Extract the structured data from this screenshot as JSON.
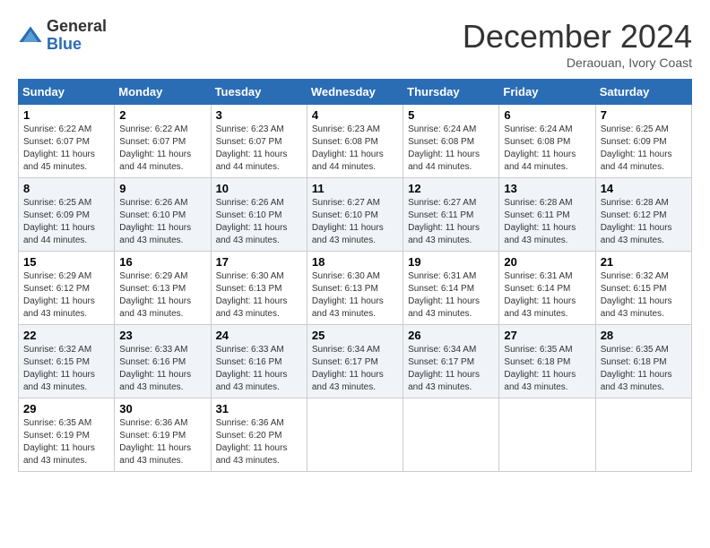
{
  "logo": {
    "general": "General",
    "blue": "Blue"
  },
  "header": {
    "month": "December 2024",
    "location": "Deraouan, Ivory Coast"
  },
  "weekdays": [
    "Sunday",
    "Monday",
    "Tuesday",
    "Wednesday",
    "Thursday",
    "Friday",
    "Saturday"
  ],
  "weeks": [
    [
      {
        "day": "1",
        "sunrise": "6:22 AM",
        "sunset": "6:07 PM",
        "daylight": "11 hours and 45 minutes."
      },
      {
        "day": "2",
        "sunrise": "6:22 AM",
        "sunset": "6:07 PM",
        "daylight": "11 hours and 44 minutes."
      },
      {
        "day": "3",
        "sunrise": "6:23 AM",
        "sunset": "6:07 PM",
        "daylight": "11 hours and 44 minutes."
      },
      {
        "day": "4",
        "sunrise": "6:23 AM",
        "sunset": "6:08 PM",
        "daylight": "11 hours and 44 minutes."
      },
      {
        "day": "5",
        "sunrise": "6:24 AM",
        "sunset": "6:08 PM",
        "daylight": "11 hours and 44 minutes."
      },
      {
        "day": "6",
        "sunrise": "6:24 AM",
        "sunset": "6:08 PM",
        "daylight": "11 hours and 44 minutes."
      },
      {
        "day": "7",
        "sunrise": "6:25 AM",
        "sunset": "6:09 PM",
        "daylight": "11 hours and 44 minutes."
      }
    ],
    [
      {
        "day": "8",
        "sunrise": "6:25 AM",
        "sunset": "6:09 PM",
        "daylight": "11 hours and 44 minutes."
      },
      {
        "day": "9",
        "sunrise": "6:26 AM",
        "sunset": "6:10 PM",
        "daylight": "11 hours and 43 minutes."
      },
      {
        "day": "10",
        "sunrise": "6:26 AM",
        "sunset": "6:10 PM",
        "daylight": "11 hours and 43 minutes."
      },
      {
        "day": "11",
        "sunrise": "6:27 AM",
        "sunset": "6:10 PM",
        "daylight": "11 hours and 43 minutes."
      },
      {
        "day": "12",
        "sunrise": "6:27 AM",
        "sunset": "6:11 PM",
        "daylight": "11 hours and 43 minutes."
      },
      {
        "day": "13",
        "sunrise": "6:28 AM",
        "sunset": "6:11 PM",
        "daylight": "11 hours and 43 minutes."
      },
      {
        "day": "14",
        "sunrise": "6:28 AM",
        "sunset": "6:12 PM",
        "daylight": "11 hours and 43 minutes."
      }
    ],
    [
      {
        "day": "15",
        "sunrise": "6:29 AM",
        "sunset": "6:12 PM",
        "daylight": "11 hours and 43 minutes."
      },
      {
        "day": "16",
        "sunrise": "6:29 AM",
        "sunset": "6:13 PM",
        "daylight": "11 hours and 43 minutes."
      },
      {
        "day": "17",
        "sunrise": "6:30 AM",
        "sunset": "6:13 PM",
        "daylight": "11 hours and 43 minutes."
      },
      {
        "day": "18",
        "sunrise": "6:30 AM",
        "sunset": "6:13 PM",
        "daylight": "11 hours and 43 minutes."
      },
      {
        "day": "19",
        "sunrise": "6:31 AM",
        "sunset": "6:14 PM",
        "daylight": "11 hours and 43 minutes."
      },
      {
        "day": "20",
        "sunrise": "6:31 AM",
        "sunset": "6:14 PM",
        "daylight": "11 hours and 43 minutes."
      },
      {
        "day": "21",
        "sunrise": "6:32 AM",
        "sunset": "6:15 PM",
        "daylight": "11 hours and 43 minutes."
      }
    ],
    [
      {
        "day": "22",
        "sunrise": "6:32 AM",
        "sunset": "6:15 PM",
        "daylight": "11 hours and 43 minutes."
      },
      {
        "day": "23",
        "sunrise": "6:33 AM",
        "sunset": "6:16 PM",
        "daylight": "11 hours and 43 minutes."
      },
      {
        "day": "24",
        "sunrise": "6:33 AM",
        "sunset": "6:16 PM",
        "daylight": "11 hours and 43 minutes."
      },
      {
        "day": "25",
        "sunrise": "6:34 AM",
        "sunset": "6:17 PM",
        "daylight": "11 hours and 43 minutes."
      },
      {
        "day": "26",
        "sunrise": "6:34 AM",
        "sunset": "6:17 PM",
        "daylight": "11 hours and 43 minutes."
      },
      {
        "day": "27",
        "sunrise": "6:35 AM",
        "sunset": "6:18 PM",
        "daylight": "11 hours and 43 minutes."
      },
      {
        "day": "28",
        "sunrise": "6:35 AM",
        "sunset": "6:18 PM",
        "daylight": "11 hours and 43 minutes."
      }
    ],
    [
      {
        "day": "29",
        "sunrise": "6:35 AM",
        "sunset": "6:19 PM",
        "daylight": "11 hours and 43 minutes."
      },
      {
        "day": "30",
        "sunrise": "6:36 AM",
        "sunset": "6:19 PM",
        "daylight": "11 hours and 43 minutes."
      },
      {
        "day": "31",
        "sunrise": "6:36 AM",
        "sunset": "6:20 PM",
        "daylight": "11 hours and 43 minutes."
      },
      null,
      null,
      null,
      null
    ]
  ],
  "labels": {
    "sunrise": "Sunrise:",
    "sunset": "Sunset:",
    "daylight": "Daylight:"
  }
}
